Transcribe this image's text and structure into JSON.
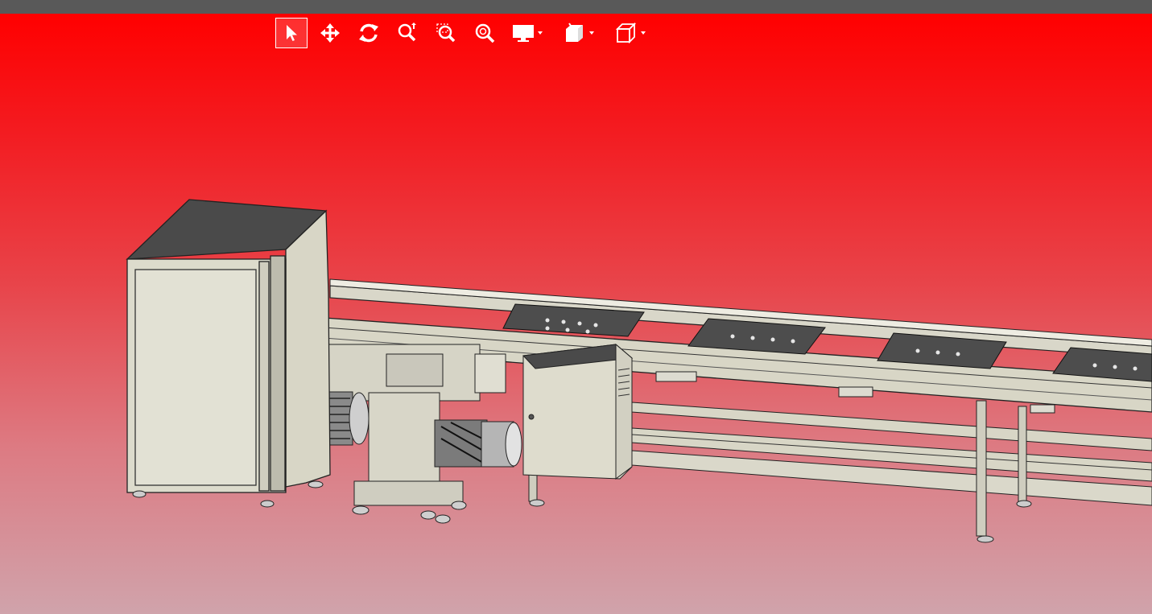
{
  "app": {
    "accent_color": "#ff0000",
    "titlebar_color": "#595959"
  },
  "toolbar": {
    "tools": [
      {
        "name": "select",
        "icon": "arrow-cursor-icon",
        "active": true
      },
      {
        "name": "pan",
        "icon": "move-arrows-icon",
        "active": false
      },
      {
        "name": "rotate",
        "icon": "rotate-icon",
        "active": false
      },
      {
        "name": "zoom",
        "icon": "zoom-icon",
        "active": false
      },
      {
        "name": "zoom-window",
        "icon": "zoom-window-icon",
        "active": false
      },
      {
        "name": "zoom-fit",
        "icon": "zoom-fit-icon",
        "active": false
      }
    ],
    "dropdowns": [
      {
        "name": "display-mode",
        "icon": "monitor-icon"
      },
      {
        "name": "section",
        "icon": "section-cube-icon"
      },
      {
        "name": "view-orientation",
        "icon": "view-cube-icon"
      }
    ]
  },
  "model": {
    "description_icon": "conveyor-assembly-3d-model"
  }
}
